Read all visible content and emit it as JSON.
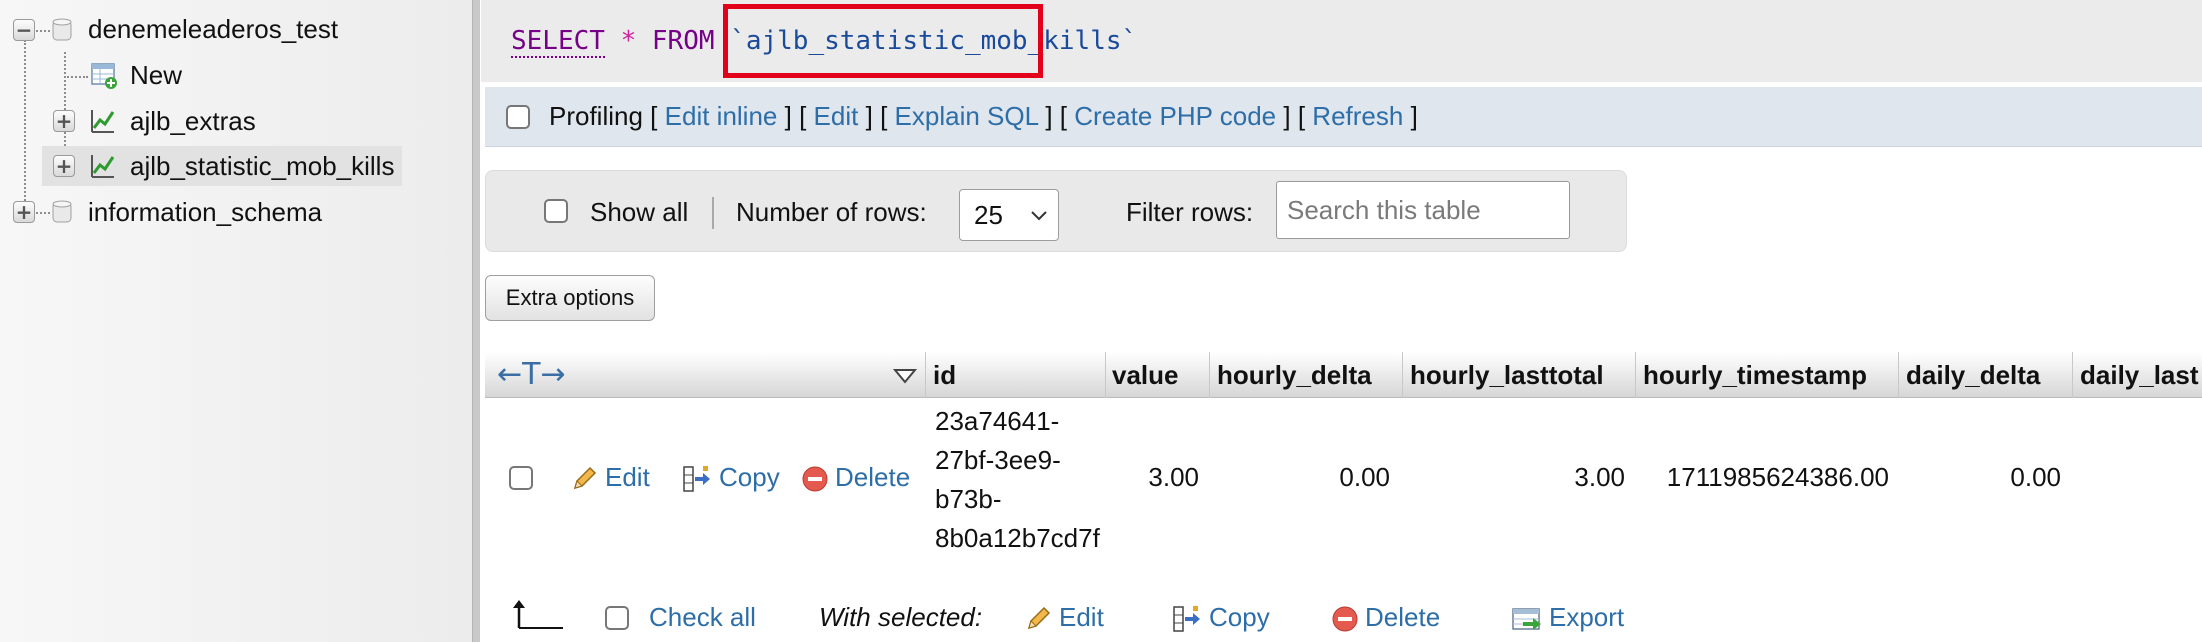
{
  "nav": {
    "items": [
      {
        "label": "denemeleaderos_test",
        "expanded": true
      },
      {
        "label": "New"
      },
      {
        "label": "ajlb_extras"
      },
      {
        "label": "ajlb_statistic_mob_kills",
        "selected": true
      },
      {
        "label": "information_schema"
      }
    ]
  },
  "sql": {
    "select": "SELECT",
    "star": "*",
    "from": "FROM",
    "table": "`ajlb_statistic_mob_kills`"
  },
  "profiling": {
    "label": "Profiling",
    "links": [
      "Edit inline",
      "Edit",
      "Explain SQL",
      "Create PHP code",
      "Refresh"
    ],
    "bracket_open": "[",
    "bracket_close": "]"
  },
  "filters": {
    "show_all": "Show all",
    "num_rows_label": "Number of rows:",
    "num_rows_value": "25",
    "filter_label": "Filter rows:",
    "search_placeholder": "Search this table"
  },
  "extra_options": "Extra options",
  "table": {
    "arrows": "←T→",
    "columns": [
      "id",
      "value",
      "hourly_delta",
      "hourly_lasttotal",
      "hourly_timestamp",
      "daily_delta",
      "daily_last"
    ],
    "row_actions": {
      "edit": "Edit",
      "copy": "Copy",
      "delete": "Delete"
    },
    "rows": [
      {
        "id_lines": [
          "23a74641-",
          "27bf-3ee9-",
          "b73b-",
          "8b0a12b7cd7f"
        ],
        "value": "3.00",
        "hourly_delta": "0.00",
        "hourly_lasttotal": "3.00",
        "hourly_timestamp": "1711985624386.00",
        "daily_delta": "0.00"
      }
    ]
  },
  "footer": {
    "check_all": "Check all",
    "with_selected": "With selected:",
    "edit": "Edit",
    "copy": "Copy",
    "delete": "Delete",
    "export": "Export"
  },
  "colors": {
    "link": "#2e6ea8",
    "highlight": "#e3001b",
    "sql_keyword": "#770088"
  }
}
